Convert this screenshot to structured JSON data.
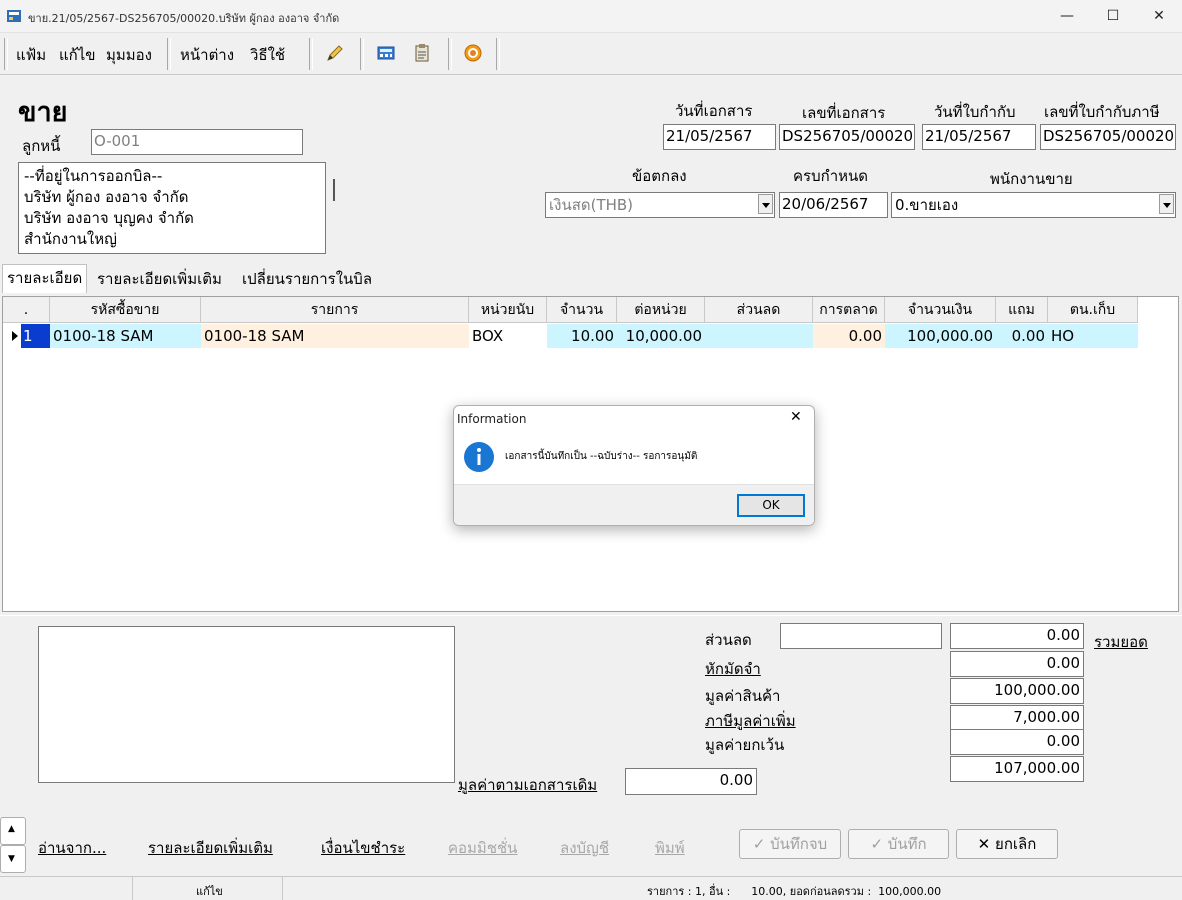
{
  "window": {
    "title": "ขาย.21/05/2567-DS256705/00020.บริษัท ผู้กอง องอาจ จำกัด",
    "minimize": "—",
    "maximize": "☐",
    "close": "✕"
  },
  "menu": {
    "file": "แฟ้ม",
    "edit": "แก้ไข",
    "view": "มุมมอง",
    "window": "หน้าต่าง",
    "help": "วิธีใช้"
  },
  "form": {
    "heading": "ขาย",
    "debtor_label": "ลูกหนี้",
    "debtor_value": "O-001",
    "billing_address": [
      "--ที่อยู่ในการออกบิล--",
      "บริษัท ผู้กอง องอาจ จำกัด",
      "บริษัท องอาจ บุญคง จำกัด",
      "สำนักงานใหญ่"
    ],
    "doc_date_label": "วันที่เอกสาร",
    "doc_date": "21/05/2567",
    "doc_no_label": "เลขที่เอกสาร",
    "doc_no": "DS256705/00020",
    "invoice_date_label": "วันที่ใบกำกับ",
    "invoice_date": "21/05/2567",
    "tax_invoice_label": "เลขที่ใบกำกับภาษี",
    "tax_invoice_no": "DS256705/00020",
    "terms_label": "ข้อตกลง",
    "terms_value": "เงินสด(THB)",
    "due_label": "ครบกำหนด",
    "due_date": "20/06/2567",
    "salesperson_label": "พนักงานขาย",
    "salesperson_value": "0.ขายเอง"
  },
  "tabs": [
    "รายละเอียด",
    "รายละเอียดเพิ่มเติม",
    "เปลี่ยนรายการในบิล"
  ],
  "grid": {
    "headers": [
      ".",
      "รหัสซื้อขาย",
      "รายการ",
      "หน่วยนับ",
      "จำนวน",
      "ต่อหน่วย",
      "ส่วนลด",
      "การตลาด",
      "จำนวนเงิน",
      "แถม",
      "ตน.เก็บ"
    ],
    "row": {
      "no": "1",
      "code": "0100-18 SAM",
      "item": "0100-18 SAM",
      "unit": "BOX",
      "qty": "10.00",
      "price": "10,000.00",
      "discount": "",
      "marketing": "0.00",
      "amount": "100,000.00",
      "free": "0.00",
      "location": "HO"
    }
  },
  "dialog": {
    "title": "Information",
    "close": "✕",
    "message": "เอกสารนี้บันทึกเป็น --ฉบับร่าง-- รอการอนุมัติ",
    "ok": "OK"
  },
  "totals": {
    "discount_label": "ส่วนลด",
    "discount_input": "",
    "discount_value": "0.00",
    "sum_link": "รวมยอด",
    "deposit_label": "หักมัดจำ",
    "deposit_value": "0.00",
    "goods_label": "มูลค่าสินค้า",
    "goods_value": "100,000.00",
    "vat_label": "ภาษีมูลค่าเพิ่ม",
    "vat_value": "7,000.00",
    "exempt_label": "มูลค่ายกเว้น",
    "exempt_value": "0.00",
    "grand_total": "107,000.00",
    "orig_doc_label": "มูลค่าตามเอกสารเดิม",
    "orig_doc_value": "0.00"
  },
  "actions": {
    "read_from": "อ่านจาก...",
    "more_details": "รายละเอียดเพิ่มเติม",
    "payment_terms": "เงื่อนไขชำระ",
    "commission": "คอมมิชชั่น",
    "post_ledger": "ลงบัญชี",
    "print": "พิมพ์",
    "save_close": "บันทึกจบ",
    "save": "บันทึก",
    "cancel": "ยกเลิก",
    "save_close_icon": "✓",
    "save_icon": "✓",
    "cancel_icon": "✕",
    "spin_up": "▲",
    "spin_down": "▼"
  },
  "status": {
    "mode": "แก้ไข",
    "summary": "รายการ : 1, อื่น :      10.00, ยอดก่อนลดรวม :  100,000.00"
  }
}
